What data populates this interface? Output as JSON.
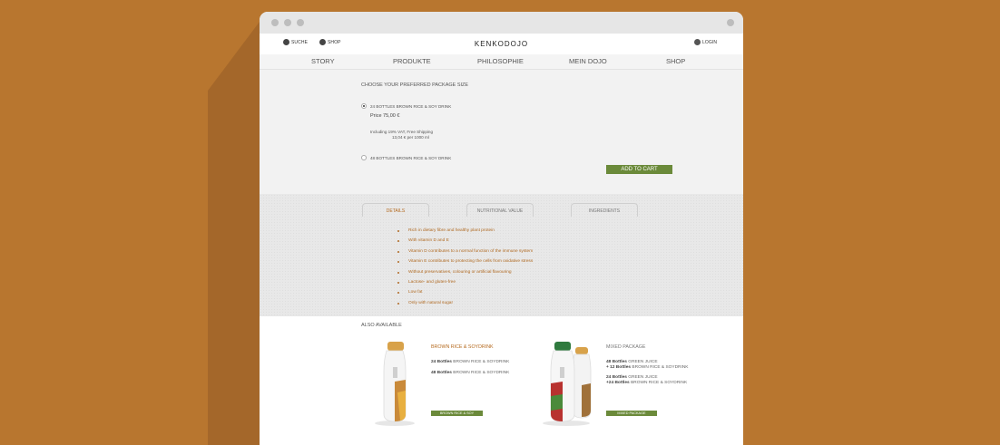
{
  "header": {
    "search_label": "SUCHE",
    "shop_label": "SHOP",
    "logo": "KENKODOJO",
    "login_label": "LOGIN"
  },
  "nav": {
    "items": [
      "STORY",
      "PRODUKTE",
      "PHILOSOPHIE",
      "MEIN DOJO",
      "SHOP"
    ]
  },
  "purchase": {
    "heading": "CHOOSE YOUR PREFERRED PACKAGE SIZE",
    "option1": "24 BOTTLES BROWN RICE & SOY DRINK",
    "price": "Price 75,00 €",
    "vat_line": "Including 19% VAT, Free Shipping",
    "per_liter": "13,04 € per 1000 ml",
    "option2": "48 BOTTLES BROWN RICE & SOY DRINK",
    "cart_button": "ADD TO CART"
  },
  "tabs": [
    "DETAILS",
    "NUTRITIONAL VALUE",
    "INGREDIENTS"
  ],
  "details": [
    "Rich in dietary fibre and healthy plant protein",
    "With vitamin D and E",
    "Vitamin D contributes to a normal function of the immune system",
    "Vitamin E contributes to protecting the cells from oxidative stress",
    "Without preservatives, colouring or artificial flavouring",
    "Lactose- and gluten-free",
    "Low fat",
    "Only with natural sugar"
  ],
  "also": {
    "heading": "ALSO AVAILABLE",
    "p1": {
      "title": "BROWN RICE & SOYDRINK",
      "l1b": "24 Bottles",
      "l1": "BROWN RICE & SOYDRINK",
      "l2b": "48 Bottles",
      "l2": "BROWN RICE & SOYDRINK",
      "button": "BROWN RICE & SOY"
    },
    "p2": {
      "title": "MIXED PACKAGE",
      "l1b": "48 Bottles",
      "l1": "GREEN JUICE",
      "l2b": "+ 12 Bottles",
      "l2": "BROWN RICE & SOYDRINK",
      "l3b": "24 Bottles",
      "l3": "GREEN JUICE",
      "l4b": "+24 Bottles",
      "l4": "BROWN RICE & SOYDRINK",
      "button": "MIXED PACKAGE"
    }
  },
  "colors": {
    "background": "#b8762f",
    "accent_orange": "#b56a1f",
    "button_green": "#6b8a3a"
  }
}
